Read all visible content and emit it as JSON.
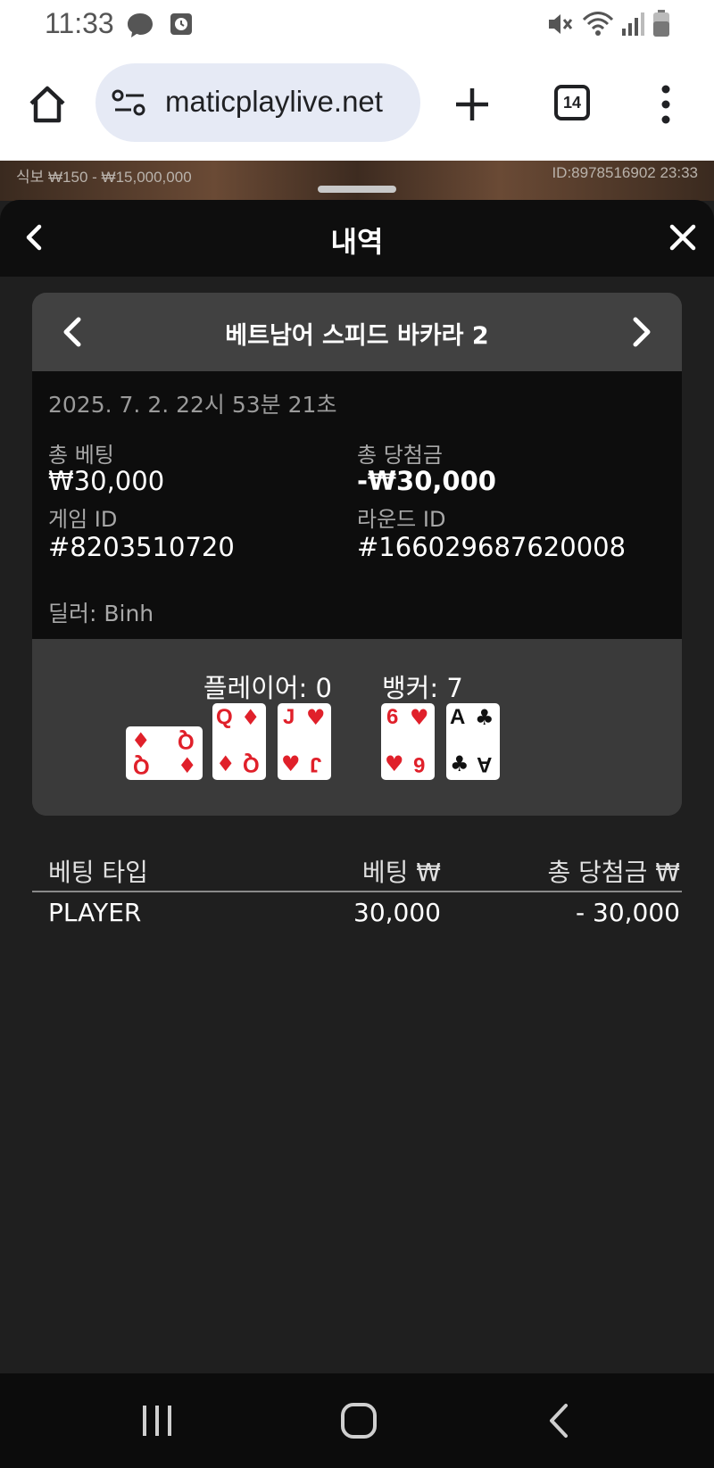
{
  "status_bar": {
    "time": "11:33",
    "icons": [
      "messenger-icon",
      "alarm-icon",
      "mute-icon",
      "wifi-icon",
      "signal-icon",
      "battery-icon"
    ]
  },
  "browser": {
    "url": "maticplaylive.net",
    "tab_count": "14",
    "icons": [
      "home-icon",
      "site-settings-icon",
      "new-tab-icon",
      "tabs-icon",
      "more-icon"
    ]
  },
  "game_strip": {
    "limits": "식보 ₩150 - ₩15,000,000",
    "id_time": "ID:8978516902  23:33"
  },
  "panel": {
    "title": "내역"
  },
  "record": {
    "game_name": "베트남어 스피드 바카라 2",
    "datetime": "2025. 7. 2. 22시 53분 21초",
    "total_bet_label": "총 베팅",
    "total_bet_value": "₩30,000",
    "total_win_label": "총 당첨금",
    "total_win_value": "-₩30,000",
    "game_id_label": "게임 ID",
    "game_id_value": "#8203510720",
    "round_id_label": "라운드 ID",
    "round_id_value": "#166029687620008",
    "dealer": "딜러: Binh",
    "player_score": "플레이어: 0",
    "banker_score": "뱅커: 7",
    "player_cards": [
      {
        "rank": "Q",
        "suit": "♦",
        "color": "#e0202a",
        "orientation": "sideways"
      },
      {
        "rank": "Q",
        "suit": "♦",
        "color": "#e0202a",
        "orientation": "upright"
      },
      {
        "rank": "J",
        "suit": "♥",
        "color": "#e0202a",
        "orientation": "upright"
      }
    ],
    "banker_cards": [
      {
        "rank": "6",
        "suit": "♥",
        "color": "#e0202a",
        "orientation": "upright"
      },
      {
        "rank": "A",
        "suit": "♣",
        "color": "#111111",
        "orientation": "upright"
      }
    ]
  },
  "bets": {
    "headers": {
      "type": "베팅 타입",
      "bet": "베팅 ₩",
      "win": "총 당첨금 ₩"
    },
    "rows": [
      {
        "type": "PLAYER",
        "bet": "30,000",
        "win": "- 30,000"
      }
    ]
  },
  "colors": {
    "panel_bg": "#1f1f1f",
    "header_bg": "#0e0e0e",
    "card_bg": "#3a3a3a",
    "info_bg": "#0d0d0d",
    "red_suit": "#e0202a"
  },
  "system_nav": {
    "icons": [
      "recent-apps-icon",
      "home-button-icon",
      "back-icon"
    ]
  }
}
